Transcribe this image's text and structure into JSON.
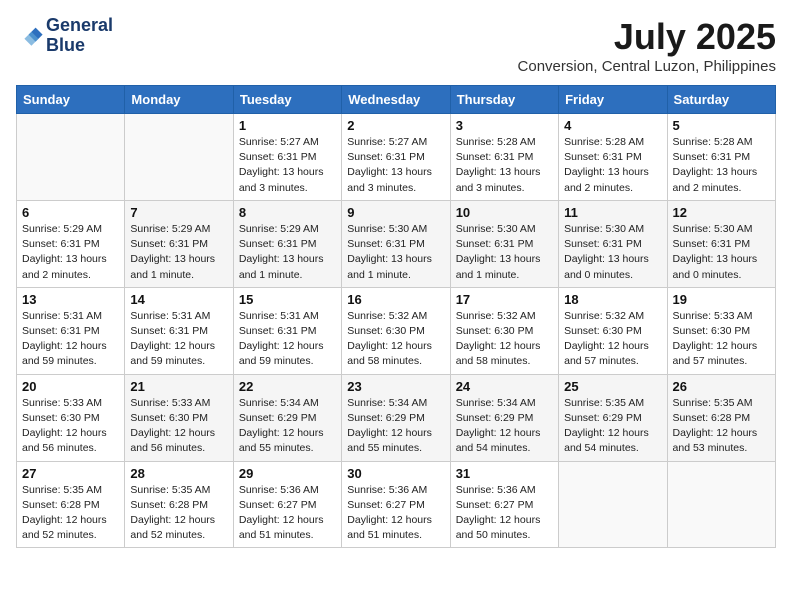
{
  "header": {
    "logo_line1": "General",
    "logo_line2": "Blue",
    "month_year": "July 2025",
    "location": "Conversion, Central Luzon, Philippines"
  },
  "days_of_week": [
    "Sunday",
    "Monday",
    "Tuesday",
    "Wednesday",
    "Thursday",
    "Friday",
    "Saturday"
  ],
  "weeks": [
    [
      {
        "day": "",
        "info": ""
      },
      {
        "day": "",
        "info": ""
      },
      {
        "day": "1",
        "info": "Sunrise: 5:27 AM\nSunset: 6:31 PM\nDaylight: 13 hours and 3 minutes."
      },
      {
        "day": "2",
        "info": "Sunrise: 5:27 AM\nSunset: 6:31 PM\nDaylight: 13 hours and 3 minutes."
      },
      {
        "day": "3",
        "info": "Sunrise: 5:28 AM\nSunset: 6:31 PM\nDaylight: 13 hours and 3 minutes."
      },
      {
        "day": "4",
        "info": "Sunrise: 5:28 AM\nSunset: 6:31 PM\nDaylight: 13 hours and 2 minutes."
      },
      {
        "day": "5",
        "info": "Sunrise: 5:28 AM\nSunset: 6:31 PM\nDaylight: 13 hours and 2 minutes."
      }
    ],
    [
      {
        "day": "6",
        "info": "Sunrise: 5:29 AM\nSunset: 6:31 PM\nDaylight: 13 hours and 2 minutes."
      },
      {
        "day": "7",
        "info": "Sunrise: 5:29 AM\nSunset: 6:31 PM\nDaylight: 13 hours and 1 minute."
      },
      {
        "day": "8",
        "info": "Sunrise: 5:29 AM\nSunset: 6:31 PM\nDaylight: 13 hours and 1 minute."
      },
      {
        "day": "9",
        "info": "Sunrise: 5:30 AM\nSunset: 6:31 PM\nDaylight: 13 hours and 1 minute."
      },
      {
        "day": "10",
        "info": "Sunrise: 5:30 AM\nSunset: 6:31 PM\nDaylight: 13 hours and 1 minute."
      },
      {
        "day": "11",
        "info": "Sunrise: 5:30 AM\nSunset: 6:31 PM\nDaylight: 13 hours and 0 minutes."
      },
      {
        "day": "12",
        "info": "Sunrise: 5:30 AM\nSunset: 6:31 PM\nDaylight: 13 hours and 0 minutes."
      }
    ],
    [
      {
        "day": "13",
        "info": "Sunrise: 5:31 AM\nSunset: 6:31 PM\nDaylight: 12 hours and 59 minutes."
      },
      {
        "day": "14",
        "info": "Sunrise: 5:31 AM\nSunset: 6:31 PM\nDaylight: 12 hours and 59 minutes."
      },
      {
        "day": "15",
        "info": "Sunrise: 5:31 AM\nSunset: 6:31 PM\nDaylight: 12 hours and 59 minutes."
      },
      {
        "day": "16",
        "info": "Sunrise: 5:32 AM\nSunset: 6:30 PM\nDaylight: 12 hours and 58 minutes."
      },
      {
        "day": "17",
        "info": "Sunrise: 5:32 AM\nSunset: 6:30 PM\nDaylight: 12 hours and 58 minutes."
      },
      {
        "day": "18",
        "info": "Sunrise: 5:32 AM\nSunset: 6:30 PM\nDaylight: 12 hours and 57 minutes."
      },
      {
        "day": "19",
        "info": "Sunrise: 5:33 AM\nSunset: 6:30 PM\nDaylight: 12 hours and 57 minutes."
      }
    ],
    [
      {
        "day": "20",
        "info": "Sunrise: 5:33 AM\nSunset: 6:30 PM\nDaylight: 12 hours and 56 minutes."
      },
      {
        "day": "21",
        "info": "Sunrise: 5:33 AM\nSunset: 6:30 PM\nDaylight: 12 hours and 56 minutes."
      },
      {
        "day": "22",
        "info": "Sunrise: 5:34 AM\nSunset: 6:29 PM\nDaylight: 12 hours and 55 minutes."
      },
      {
        "day": "23",
        "info": "Sunrise: 5:34 AM\nSunset: 6:29 PM\nDaylight: 12 hours and 55 minutes."
      },
      {
        "day": "24",
        "info": "Sunrise: 5:34 AM\nSunset: 6:29 PM\nDaylight: 12 hours and 54 minutes."
      },
      {
        "day": "25",
        "info": "Sunrise: 5:35 AM\nSunset: 6:29 PM\nDaylight: 12 hours and 54 minutes."
      },
      {
        "day": "26",
        "info": "Sunrise: 5:35 AM\nSunset: 6:28 PM\nDaylight: 12 hours and 53 minutes."
      }
    ],
    [
      {
        "day": "27",
        "info": "Sunrise: 5:35 AM\nSunset: 6:28 PM\nDaylight: 12 hours and 52 minutes."
      },
      {
        "day": "28",
        "info": "Sunrise: 5:35 AM\nSunset: 6:28 PM\nDaylight: 12 hours and 52 minutes."
      },
      {
        "day": "29",
        "info": "Sunrise: 5:36 AM\nSunset: 6:27 PM\nDaylight: 12 hours and 51 minutes."
      },
      {
        "day": "30",
        "info": "Sunrise: 5:36 AM\nSunset: 6:27 PM\nDaylight: 12 hours and 51 minutes."
      },
      {
        "day": "31",
        "info": "Sunrise: 5:36 AM\nSunset: 6:27 PM\nDaylight: 12 hours and 50 minutes."
      },
      {
        "day": "",
        "info": ""
      },
      {
        "day": "",
        "info": ""
      }
    ]
  ]
}
